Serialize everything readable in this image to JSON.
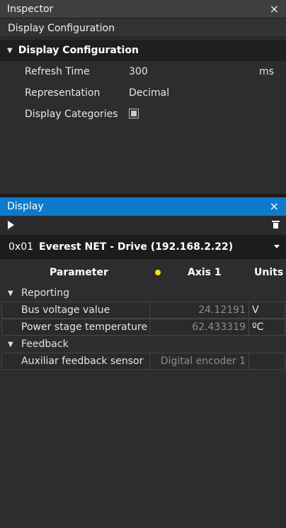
{
  "inspector": {
    "title": "Inspector",
    "close": "×",
    "subheader": "Display Configuration",
    "section": "Display Configuration",
    "properties": [
      {
        "label": "Refresh Time",
        "value": "300",
        "unit": "ms"
      },
      {
        "label": "Representation",
        "value": "Decimal"
      },
      {
        "label": "Display Categories",
        "checked": true
      }
    ]
  },
  "display": {
    "title": "Display",
    "close": "×",
    "drive": {
      "id": "0x01",
      "name": "Everest NET - Drive (192.168.2.22)"
    },
    "status_color": "#f2e01c",
    "columns": {
      "parameter": "Parameter",
      "axis": "Axis 1",
      "units": "Units"
    },
    "groups": [
      {
        "name": "Reporting",
        "rows": [
          {
            "name": "Bus voltage value",
            "value": "24.12191",
            "unit": "V"
          },
          {
            "name": "Power stage temperature",
            "value": "62.433319",
            "unit": "ºC"
          }
        ]
      },
      {
        "name": "Feedback",
        "rows": [
          {
            "name": "Auxiliar feedback sensor",
            "value": "Digital encoder 1",
            "unit": ""
          }
        ]
      }
    ]
  },
  "colors": {
    "accent": "#0e7acc",
    "background": "#2d2d30"
  }
}
